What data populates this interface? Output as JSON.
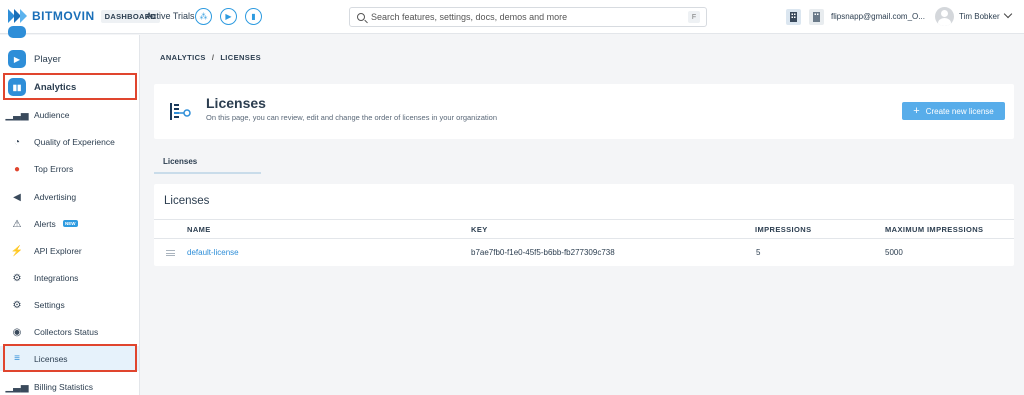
{
  "topbar": {
    "brand": "BITMOVIN",
    "dashboard_badge": "DASHBOARD",
    "active_trials_label": "Active Trials",
    "search_placeholder": "Search features, settings, docs, demos and more",
    "search_shortcut": "F",
    "email": "flipsnapp@gmail.com_O...",
    "username": "Tim Bobker"
  },
  "sidebar": {
    "items": [
      {
        "label": "Player"
      },
      {
        "label": "Analytics"
      },
      {
        "label": "Audience"
      },
      {
        "label": "Quality of Experience"
      },
      {
        "label": "Top Errors"
      },
      {
        "label": "Advertising"
      },
      {
        "label": "Alerts"
      },
      {
        "label": "API Explorer"
      },
      {
        "label": "Integrations"
      },
      {
        "label": "Settings"
      },
      {
        "label": "Collectors Status"
      },
      {
        "label": "Licenses"
      },
      {
        "label": "Billing Statistics"
      }
    ],
    "alerts_badge": "NEW"
  },
  "breadcrumb": {
    "root": "ANALYTICS",
    "separator": "/",
    "current": "LICENSES"
  },
  "header": {
    "title": "Licenses",
    "subtitle": "On this page, you can review, edit and change the order of licenses in your organization",
    "create_button": "Create new license"
  },
  "tabs": [
    {
      "label": "Licenses"
    }
  ],
  "table": {
    "title": "Licenses",
    "columns": [
      "NAME",
      "KEY",
      "IMPRESSIONS",
      "MAXIMUM IMPRESSIONS"
    ],
    "rows": [
      {
        "name": "default-license",
        "key": "b7ae7fb0-f1e0-45f5-b6bb-fb277309c738",
        "impressions": "5",
        "max_impressions": "5000"
      }
    ]
  },
  "colors": {
    "accent": "#2e8ed8",
    "button": "#58adea",
    "highlight_box": "#e0452e",
    "selected_bg": "#e6f2fb"
  }
}
